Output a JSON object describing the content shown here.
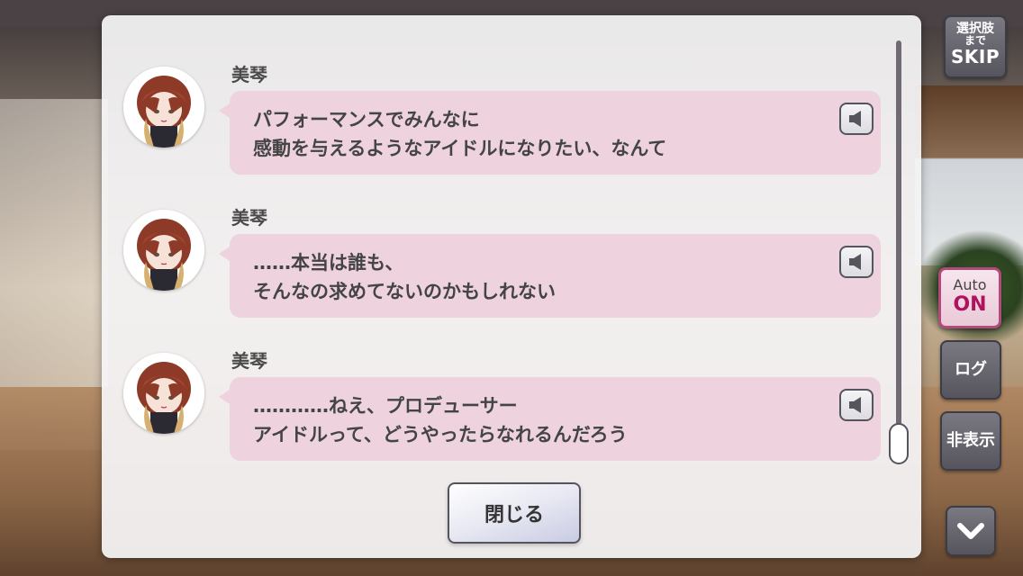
{
  "colors": {
    "bubble": "#eed3df",
    "panel": "#f4f3f4",
    "auto_on": "#b0125e",
    "button_border": "#55555e"
  },
  "log": {
    "entries": [
      {
        "speaker": "美琴",
        "lines": [
          "パフォーマンスでみんなに",
          "感動を与えるようなアイドルになりたい、なんて"
        ],
        "voice_icon": "speaker-icon"
      },
      {
        "speaker": "美琴",
        "lines": [
          "……本当は誰も、",
          "そんなの求めてないのかもしれない"
        ],
        "voice_icon": "speaker-icon"
      },
      {
        "speaker": "美琴",
        "lines": [
          "…………ねえ、プロデューサー",
          "アイドルって、どうやったらなれるんだろう"
        ],
        "voice_icon": "speaker-icon"
      }
    ],
    "close_label": "閉じる"
  },
  "side": {
    "skip": {
      "top": "選択肢",
      "mid": "まで",
      "main": "SKIP"
    },
    "auto": {
      "label": "Auto",
      "state": "ON"
    },
    "log_label": "ログ",
    "hide_label": "非表示",
    "down_icon": "chevron-down-icon"
  }
}
